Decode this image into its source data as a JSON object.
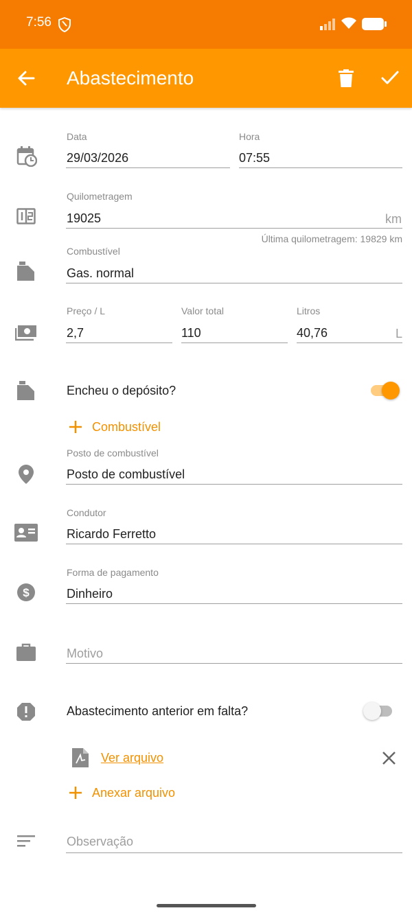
{
  "status_bar": {
    "time": "7:56"
  },
  "app_bar": {
    "title": "Abastecimento"
  },
  "date": {
    "label": "Data",
    "value": "29/03/2026"
  },
  "time": {
    "label": "Hora",
    "value": "07:55"
  },
  "odometer": {
    "label": "Quilometragem",
    "value": "19025",
    "unit": "km",
    "hint": "Última quilometragem: 19829 km"
  },
  "fuel": {
    "label": "Combustível",
    "value": "Gas. normal"
  },
  "price": {
    "label": "Preço / L",
    "value": "2,7"
  },
  "total": {
    "label": "Valor total",
    "value": "110"
  },
  "liters": {
    "label": "Litros",
    "value": "40,76",
    "unit": "L"
  },
  "full_tank": {
    "label": "Encheu o depósito?",
    "checked": true
  },
  "add_fuel": {
    "label": "Combustível"
  },
  "station": {
    "label": "Posto de combustível",
    "value": "Posto de combustível"
  },
  "driver": {
    "label": "Condutor",
    "value": "Ricardo Ferretto"
  },
  "payment": {
    "label": "Forma de pagamento",
    "value": "Dinheiro"
  },
  "reason": {
    "placeholder": "Motivo"
  },
  "missed_refuel": {
    "label": "Abastecimento anterior em falta?",
    "checked": false
  },
  "attachment": {
    "link": "Ver arquivo"
  },
  "attach": {
    "label": "Anexar arquivo"
  },
  "notes": {
    "placeholder": "Observação"
  },
  "colors": {
    "primary": "#FF9800",
    "primary_dark": "#F57C00",
    "accent": "#F29100"
  }
}
